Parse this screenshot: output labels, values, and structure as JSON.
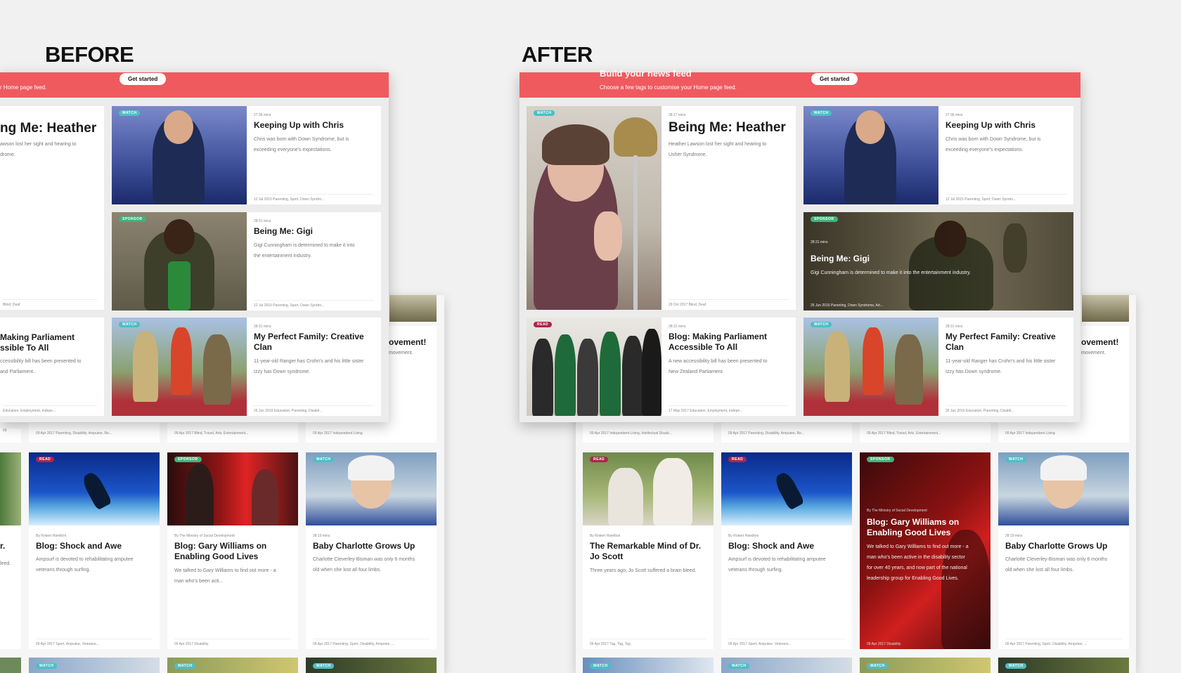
{
  "labels": {
    "before": "BEFORE",
    "after": "AFTER"
  },
  "banner": {
    "title": "Build your news feed",
    "subtitle": "Choose a few tags to customise your Home page feed.",
    "before_subtitle": "r Home page feed.",
    "button": "Get started"
  },
  "before": {
    "heather": {
      "title": "ng Me: Heather",
      "desc1": "awson lost her sight and hearing to",
      "desc2": "drome.",
      "footer": "Blind, Deaf"
    },
    "parliament": {
      "title1": "Making Parliament",
      "title2": "ssible To All",
      "desc1": "ccessibility bill has been presented to",
      "desc2": "and Parliament.",
      "footer": "Education, Employment, Indepe..."
    },
    "chris": {
      "tag": "WATCH",
      "meta": "27:36 mins",
      "title": "Keeping Up with Chris",
      "desc1": "Chris was born with Down Syndrome, but is",
      "desc2": "exceeding everyone's expectations.",
      "footer": "12 Jul 2015   Parenting, Sport, Down Syndro..."
    },
    "gigi": {
      "tag": "SPONSOR",
      "meta": "28:31 mins",
      "title": "Being Me: Gigi",
      "desc1": "Gigi Cunningham is determined to make it into",
      "desc2": "the entertainment industry.",
      "footer": "12 Jul 2015   Parenting, Sport, Down Syndro..."
    },
    "family": {
      "tag": "WATCH",
      "meta": "28:31 mins",
      "title1": "My Perfect Family: Creative",
      "title2": "Clan",
      "desc1": "11-year-old Ranger has Crohn's and his little sister",
      "desc2": "Izzy has Down syndrome.",
      "footer": "26 Jun 2016   Education, Parenting, Disabil..."
    },
    "back": {
      "movement_title": "ovement!",
      "movement_desc": "movement.",
      "footers": [
        "09 Apr 2017   Parenting, Disability, Amputee, Re...",
        "09 Apr 2017   Blind, Travel, Arts, Entertainment...",
        "09 Apr 2017   Independent Living"
      ],
      "edge_title": "r.",
      "edge_desc": "leed.",
      "shock": {
        "tag": "READ",
        "byline": "By Robert Hamilton",
        "title": "Blog: Shock and Awe",
        "desc1": "Ampsurf is devoted to rehabilitating amputee",
        "desc2": "veterans through surfing.",
        "footer": "09 Apr 2017   Sport, Amputee, Veterans..."
      },
      "gary": {
        "tag": "SPONSOR",
        "byline": "By The Ministry of Social Development",
        "title1": "Blog: Gary Williams on",
        "title2": "Enabling Good Lives",
        "desc1": "We talked to Gary Williams to find out more - a",
        "desc2": "man who's been acti...",
        "footer": "09 Apr 2017   Disability"
      },
      "charlotte": {
        "tag": "WATCH",
        "meta": "28:19 mins",
        "title": "Baby Charlotte Grows Up",
        "desc1": "Charlotte Cleverley-Bisman was only 6 months",
        "desc2": "old when she lost all four limbs.",
        "footer": "09 Apr 2017   Parenting, Sport, Disability, Amputee, ..."
      },
      "bottom_tags": [
        "WATCH",
        "WATCH",
        "WATCH"
      ]
    }
  },
  "after": {
    "heather": {
      "tag": "WATCH",
      "meta": "28:17 mins",
      "title": "Being Me: Heather",
      "desc1": "Heather Lawson lost her sight and hearing to",
      "desc2": "Usher Syndrome.",
      "footer": "29 Oct 2017   Blind, Deaf"
    },
    "chris": {
      "tag": "WATCH",
      "meta": "27:36 mins",
      "title": "Keeping Up with Chris",
      "desc1": "Chris was born with Down Syndrome, but is",
      "desc2": "exceeding everyone's expectations.",
      "footer": "12 Jul 2015   Parenting, Sport, Down Syndro..."
    },
    "gigi": {
      "tag": "SPONSOR",
      "meta": "28:31 mins",
      "title": "Being Me: Gigi",
      "desc": "Gigi Cunningham is determined to make it into the entertainment industry.",
      "footer": "26 Jun 2016   Parenting, Down Syndrome, Art..."
    },
    "parliament": {
      "tag": "READ",
      "meta": "28:31 mins",
      "title1": "Blog: Making Parliament",
      "title2": "Accessible To All",
      "desc1": "A new accessibility bill has been presented to",
      "desc2": "New Zealand Parliament.",
      "footer": "17 May 2017   Education, Employment, Indepe..."
    },
    "family": {
      "tag": "WATCH",
      "meta": "28:31 mins",
      "title1": "My Perfect Family: Creative",
      "title2": "Clan",
      "desc1": "11-year-old Ranger has Crohn's and his little sister",
      "desc2": "Izzy has Down syndrome.",
      "footer": "26 Jun 2016   Education, Parenting, Disabil..."
    },
    "back": {
      "movement_title": "ovement!",
      "movement_desc": "movement.",
      "footers": [
        "09 Apr 2017   Independent Living, Intellectual Disabi...",
        "09 Apr 2017   Parenting, Disability, Amputee, Re...",
        "09 Apr 2017   Blind, Travel, Arts, Entertainment...",
        "09 Apr 2017   Independent Living"
      ],
      "scott": {
        "tag": "READ",
        "byline": "By Robert Hamilton",
        "title1": "The Remarkable Mind of Dr.",
        "title2": "Jo Scott",
        "desc": "Three years ago, Jo Scott suffered a brain bleed.",
        "footer": "09 Apr 2017   Tag, Tag, Tag"
      },
      "shock": {
        "tag": "READ",
        "byline": "By Robert Hamilton",
        "title": "Blog: Shock and Awe",
        "desc1": "Ampsurf is devoted to rehabilitating amputee",
        "desc2": "veterans through surfing.",
        "footer": "09 Apr 2017   Sport, Amputee, Veterans..."
      },
      "gary": {
        "tag": "SPONSOR",
        "byline": "By The Ministry of Social Development",
        "title1": "Blog: Gary Williams on",
        "title2": "Enabling Good Lives",
        "desc1": "We talked to Gary Williams to find out more - a",
        "desc2": "man who's been active in the disability sector",
        "desc3": "for over 40 years, and now part of the national",
        "desc4": "leadership group for Enabling Good Lives.",
        "footer": "09 Apr 2017   Disability"
      },
      "charlotte": {
        "tag": "WATCH",
        "meta": "28:19 mins",
        "title": "Baby Charlotte Grows Up",
        "desc1": "Charlotte Cleverley-Bisman was only 6 months",
        "desc2": "old when she lost all four limbs.",
        "footer": "09 Apr 2017   Parenting, Sport, Disability, Amputee, ..."
      },
      "bottom_tags": [
        "WATCH",
        "WATCH",
        "WATCH",
        "WATCH"
      ]
    }
  }
}
